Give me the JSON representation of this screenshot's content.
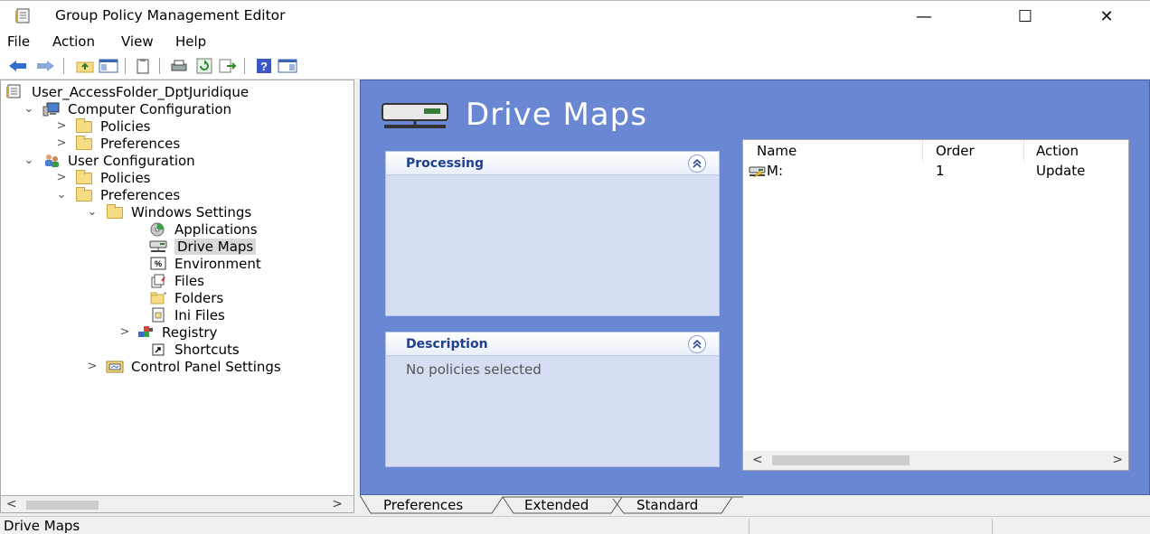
{
  "window": {
    "title": "Group Policy Management Editor",
    "minimize_glyph": "—",
    "maximize_glyph": "☐",
    "close_glyph": "✕"
  },
  "menu": [
    "File",
    "Action",
    "View",
    "Help"
  ],
  "toolbar": {
    "icons": [
      "back-icon",
      "forward-icon",
      "up-folder-icon",
      "show-hide-console-tree-icon",
      "properties-icon",
      "print-icon",
      "refresh-icon",
      "export-list-icon",
      "help-icon",
      "show-action-pane-icon"
    ]
  },
  "tree": {
    "items": [
      {
        "label": "User_AccessFolder_DptJuridique",
        "icon": "gpo-icon",
        "expander": ""
      },
      {
        "label": "Computer Configuration",
        "icon": "computer-icon",
        "expander": "⌄"
      },
      {
        "label": "Policies",
        "icon": "folder-icon",
        "expander": ">"
      },
      {
        "label": "Preferences",
        "icon": "folder-icon",
        "expander": ">"
      },
      {
        "label": "User Configuration",
        "icon": "users-icon",
        "expander": "⌄"
      },
      {
        "label": "Policies",
        "icon": "folder-icon",
        "expander": ">"
      },
      {
        "label": "Preferences",
        "icon": "folder-icon",
        "expander": "⌄"
      },
      {
        "label": "Windows Settings",
        "icon": "folder-icon",
        "expander": "⌄"
      },
      {
        "label": "Applications",
        "icon": "applications-icon",
        "expander": ""
      },
      {
        "label": "Drive Maps",
        "icon": "drive-map-icon",
        "expander": ""
      },
      {
        "label": "Environment",
        "icon": "environment-icon",
        "expander": ""
      },
      {
        "label": "Files",
        "icon": "files-icon",
        "expander": ""
      },
      {
        "label": "Folders",
        "icon": "folders-icon",
        "expander": ""
      },
      {
        "label": "Ini Files",
        "icon": "ini-files-icon",
        "expander": ""
      },
      {
        "label": "Registry",
        "icon": "registry-icon",
        "expander": ">"
      },
      {
        "label": "Shortcuts",
        "icon": "shortcuts-icon",
        "expander": ""
      },
      {
        "label": "Control Panel Settings",
        "icon": "control-panel-icon",
        "expander": ">"
      }
    ],
    "scroll_left": "<",
    "scroll_right": ">"
  },
  "main": {
    "heading": "Drive Maps",
    "processing_title": "Processing",
    "description_title": "Description",
    "description_text": "No policies selected",
    "collapse_glyph": "⌃",
    "columns": [
      "Name",
      "Order",
      "Action"
    ],
    "rows": [
      {
        "name": "M:",
        "order": "1",
        "action": "Update"
      }
    ],
    "scroll_left": "<",
    "scroll_right": ">"
  },
  "tabs": [
    "Preferences",
    "Extended",
    "Standard"
  ],
  "status": {
    "text": "Drive Maps"
  },
  "colors": {
    "pane_background": "#6a87d4",
    "panel_title": "#1e3e92"
  }
}
